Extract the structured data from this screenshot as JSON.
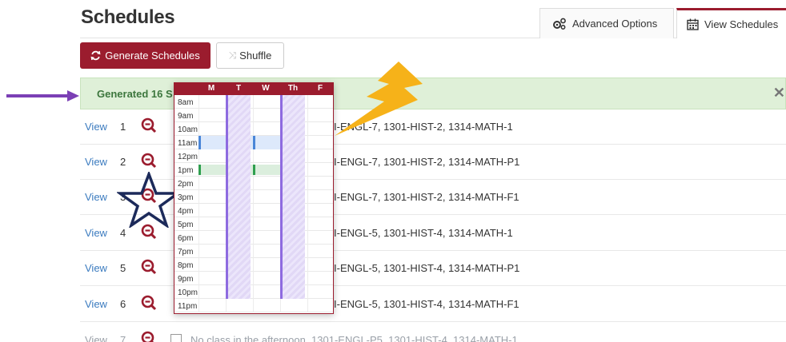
{
  "header": {
    "title": "Schedules",
    "tabs": [
      {
        "label": "Advanced Options",
        "icon": "gears-icon"
      },
      {
        "label": "View Schedules",
        "icon": "calendar-icon"
      }
    ]
  },
  "toolbar": {
    "generate_label": "Generate Schedules",
    "shuffle_label": "Shuffle"
  },
  "alert": {
    "text": "Generated 16 S",
    "close": "✕"
  },
  "rows": [
    {
      "link": "View",
      "num": "1",
      "desc": "I-ENGL-7, 1301-HIST-2, 1314-MATH-1"
    },
    {
      "link": "View",
      "num": "2",
      "desc": "I-ENGL-7, 1301-HIST-2, 1314-MATH-P1"
    },
    {
      "link": "View",
      "num": "3",
      "desc": "I-ENGL-7, 1301-HIST-2, 1314-MATH-F1"
    },
    {
      "link": "View",
      "num": "4",
      "desc": "I-ENGL-5, 1301-HIST-4, 1314-MATH-1"
    },
    {
      "link": "View",
      "num": "5",
      "desc": "I-ENGL-5, 1301-HIST-4, 1314-MATH-P1"
    },
    {
      "link": "View",
      "num": "6",
      "desc": "I-ENGL-5, 1301-HIST-4, 1314-MATH-F1"
    },
    {
      "link": "View",
      "num": "7",
      "desc": "No class in the afternoon, 1301-ENGL-P5, 1301-HIST-4, 1314-MATH-1"
    }
  ],
  "popup": {
    "days": [
      "M",
      "T",
      "W",
      "Th",
      "F"
    ],
    "hours": [
      "8am",
      "9am",
      "10am",
      "11am",
      "12pm",
      "1pm",
      "2pm",
      "3pm",
      "4pm",
      "5pm",
      "6pm",
      "7pm",
      "8pm",
      "9pm",
      "10pm",
      "11pm"
    ]
  },
  "colors": {
    "brand": "#9b1c2e",
    "alert_bg": "#dff0d8",
    "link": "#3b7bbf",
    "annotation_arrow": "#7b3fb5",
    "annotation_star": "#1c2a5a",
    "annotation_bolt": "#f6b219"
  }
}
